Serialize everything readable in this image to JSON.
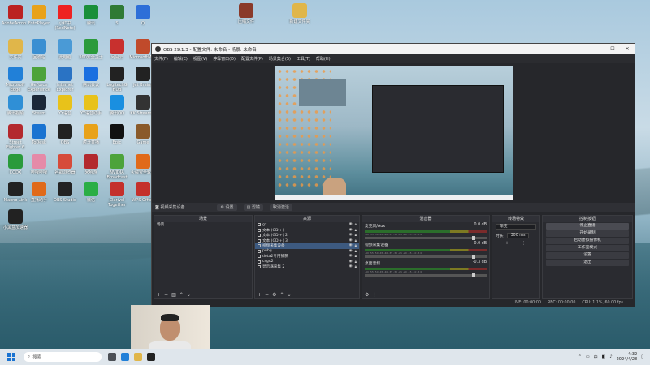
{
  "desktop": {
    "icons": [
      {
        "label": "AdobeAcrob...",
        "color": "#b22"
      },
      {
        "label": "FotoPlayer",
        "color": "#e8a21a"
      },
      {
        "label": "小红书(RedNote)",
        "color": "#e22"
      },
      {
        "label": "腾讯",
        "color": "#1a8f3a"
      },
      {
        "label": "S",
        "color": "#2f7a35"
      },
      {
        "label": "Q",
        "color": "#2d6fd8"
      },
      {
        "label": "文件夹",
        "color": "#e0b64a"
      },
      {
        "label": "回收站",
        "color": "#3a8fd2"
      },
      {
        "label": "此电脑",
        "color": "#4a9ad6"
      },
      {
        "label": "360安全卫士",
        "color": "#2b9a3b"
      },
      {
        "label": "网易云",
        "color": "#c8302e"
      },
      {
        "label": "MicrosoftMi...",
        "color": "#c04a2b"
      },
      {
        "label": "Microsoft Edge",
        "color": "#2180d8"
      },
      {
        "label": "GeForce Experience",
        "color": "#4da33b"
      },
      {
        "label": "Internet Explorer",
        "color": "#2a73c4"
      },
      {
        "label": "腾讯会议",
        "color": "#1a6fe0"
      },
      {
        "label": "LogitechG HUB",
        "color": "#222"
      },
      {
        "label": "Jet Brains",
        "color": "#222"
      },
      {
        "label": "腾讯视频",
        "color": "#2f8fd6"
      },
      {
        "label": "Steam",
        "color": "#1b2838"
      },
      {
        "label": "YY语音",
        "color": "#e8c21a"
      },
      {
        "label": "YY语音助手",
        "color": "#e8c21a"
      },
      {
        "label": "腾讯QQ",
        "color": "#1a8fe0"
      },
      {
        "label": "KK Streamer",
        "color": "#333"
      },
      {
        "label": "Street Fighter 6",
        "color": "#b3292e"
      },
      {
        "label": "ToDesk",
        "color": "#1a73d1"
      },
      {
        "label": "OBS",
        "color": "#222"
      },
      {
        "label": "虎牙直播",
        "color": "#e8a21a"
      },
      {
        "label": "Epic",
        "color": "#111"
      },
      {
        "label": "Game",
        "color": "#8a5a2a"
      },
      {
        "label": "CODX",
        "color": "#2a9a3b"
      },
      {
        "label": "哔哩哔哩",
        "color": "#e58aa8"
      },
      {
        "label": "谷歌浏览器",
        "color": "#d64b3a"
      },
      {
        "label": "米哈游",
        "color": "#b3292e"
      },
      {
        "label": "NVIDIA Broadcast",
        "color": "#4da33b"
      },
      {
        "label": "火绒安全软件",
        "color": "#e06a1a"
      },
      {
        "label": "Maono Link",
        "color": "#222"
      },
      {
        "label": "直播助手",
        "color": "#e06a1a"
      },
      {
        "label": "OBS Studio",
        "color": "#222"
      },
      {
        "label": "微信",
        "color": "#2aae45"
      },
      {
        "label": "Clarivel Together",
        "color": "#c4302b"
      },
      {
        "label": "WPS Office",
        "color": "#c4302b"
      },
      {
        "label": "小黑盒加速器",
        "color": "#222"
      }
    ],
    "top_icons": [
      {
        "label": "压缩文件",
        "color": "#8a3a2a"
      },
      {
        "label": "新建文件夹",
        "color": "#e0b64a"
      }
    ]
  },
  "obs": {
    "title": "OBS 29.1.3 - 配置文件: 未命名 - 场景: 未命名",
    "menu": [
      "文件(F)",
      "编辑(E)",
      "视图(V)",
      "停靠窗口(D)",
      "配置文件(P)",
      "场景集合(S)",
      "工具(T)",
      "帮助(H)"
    ],
    "source_bar": {
      "name": "视频采集设备",
      "properties": "设置",
      "filters": "滤镜",
      "deactivate": "取消激活"
    },
    "docks": {
      "scenes": {
        "title": "场景",
        "items": [
          "场景"
        ]
      },
      "sources": {
        "title": "来源",
        "items": [
          {
            "name": "gz"
          },
          {
            "name": "文本 (GDI+)"
          },
          {
            "name": "文本 (GDI+) 2"
          },
          {
            "name": "文本 (GDI+) 3"
          },
          {
            "name": "视频采集设备"
          },
          {
            "name": "pubg"
          },
          {
            "name": "dota2专用捕获"
          },
          {
            "name": "csgo2"
          },
          {
            "name": "显示器采集 2"
          }
        ]
      },
      "mixer": {
        "title": "混音器",
        "channels": [
          {
            "name": "麦克风/Aux",
            "db": "0.0 dB"
          },
          {
            "name": "视频采集设备",
            "db": "0.0 dB"
          },
          {
            "name": "桌面音频",
            "db": "-0.3 dB"
          }
        ],
        "ticks": "-60 -55 -50 -45 -40 -35 -30 -25 -20 -15 -10 -5 0"
      },
      "transitions": {
        "title": "转场特效",
        "type": "渐变",
        "duration_label": "时长",
        "duration": "300 ms"
      },
      "controls": {
        "title": "控制按钮",
        "buttons": [
          "停止直播",
          "开始录制",
          "启动虚拟摄像机",
          "工作室模式",
          "设置",
          "退出"
        ]
      }
    },
    "status": {
      "live": "LIVE: 00:00:00",
      "rec": "REC: 00:00:00",
      "cpu": "CPU: 1.1%, 60.00 fps"
    }
  },
  "taskbar": {
    "search_placeholder": "搜索",
    "time": "4:32",
    "date": "2024/4/28",
    "lang": "中"
  }
}
